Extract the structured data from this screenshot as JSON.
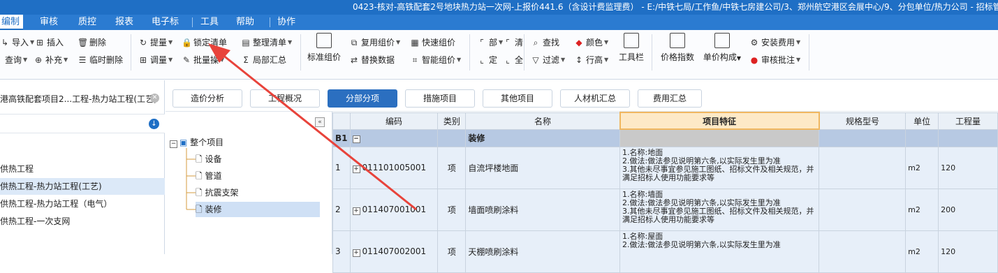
{
  "title": "0423-核对-高铁配套2号地块热力站一次网-上报价441.6（含设计费监理费） - E:/中铁七局/工作鱼/中铁七房建公司/3、郑州航空港区会展中心/9、分包单位/热力公司 - 招标管",
  "menu": {
    "items": [
      "编制",
      "审核",
      "质控",
      "报表",
      "电子标",
      "工具",
      "帮助",
      "协作"
    ]
  },
  "ribbon": {
    "import": "导入",
    "query": "查询",
    "insert": "插入",
    "supplement": "补充",
    "delete": "删除",
    "temp_delete": "临时删除",
    "extract": "提量",
    "adjust": "调量",
    "lock_list": "锁定清单",
    "batch": "批量操",
    "organize_list": "整理清单",
    "local_summary": "局部汇总",
    "standard_price": "标准组价",
    "reuse_price": "复用组价",
    "replace_data": "替换数据",
    "quick_price": "快速组价",
    "smart_price": "智能组价",
    "g1": "部",
    "g2": "清",
    "g3": "定",
    "g4": "全",
    "find": "查找",
    "filter": "过滤",
    "color": "颜色",
    "row_height": "行高",
    "toolbar": "工具栏",
    "price_index": "价格指数",
    "unit_price_comp": "单价构成",
    "install_fee": "安装费用",
    "review_note": "审核批注"
  },
  "left_pane": {
    "project": "港高铁配套项目2...工程-热力站工程(工艺)",
    "items": [
      "供热工程",
      "供热工程-热力站工程(工艺)",
      "供热工程-热力站工程（电气）",
      "供热工程-一次支网"
    ],
    "selected_index": 1
  },
  "tree": {
    "root": "整个项目",
    "children": [
      "设备",
      "管道",
      "抗震支架",
      "装修"
    ],
    "selected": "装修"
  },
  "tabs": [
    "造价分析",
    "工程概况",
    "分部分项",
    "措施项目",
    "其他项目",
    "人材机汇总",
    "费用汇总"
  ],
  "active_tab": "分部分项",
  "grid": {
    "headers": [
      "",
      "编码",
      "类别",
      "名称",
      "项目特征",
      "规格型号",
      "单位",
      "工程量"
    ],
    "group": {
      "label": "B1",
      "name": "装修"
    },
    "rows": [
      {
        "no": "1",
        "code": "011101005001",
        "type": "项",
        "name": "自流坪楼地面",
        "feature": "1.名称:地面\n2.做法:做法参见说明第六条,以实际发生里为准\n3.其他未尽事宜参见施工图纸、招标文件及相关规范，并满足招标人使用功能要求等",
        "unit": "m2",
        "qty": "120"
      },
      {
        "no": "2",
        "code": "011407001001",
        "type": "项",
        "name": "墙面喷刷涂料",
        "feature": "1.名称:墙面\n2.做法:做法参见说明第六条,以实际发生里为准\n3.其他未尽事宜参见施工图纸、招标文件及相关规范，并满足招标人使用功能要求等",
        "unit": "m2",
        "qty": "200"
      },
      {
        "no": "3",
        "code": "011407002001",
        "type": "项",
        "name": "天棚喷刷涂料",
        "feature": "1.名称:屋面\n2.做法:做法参见说明第六条,以实际发生里为准",
        "unit": "m2",
        "qty": "120"
      }
    ]
  },
  "colors": {
    "brand": "#1f6fc5",
    "annotation_arrow": "#e8433b",
    "highlight_header": "#fde9c7"
  }
}
